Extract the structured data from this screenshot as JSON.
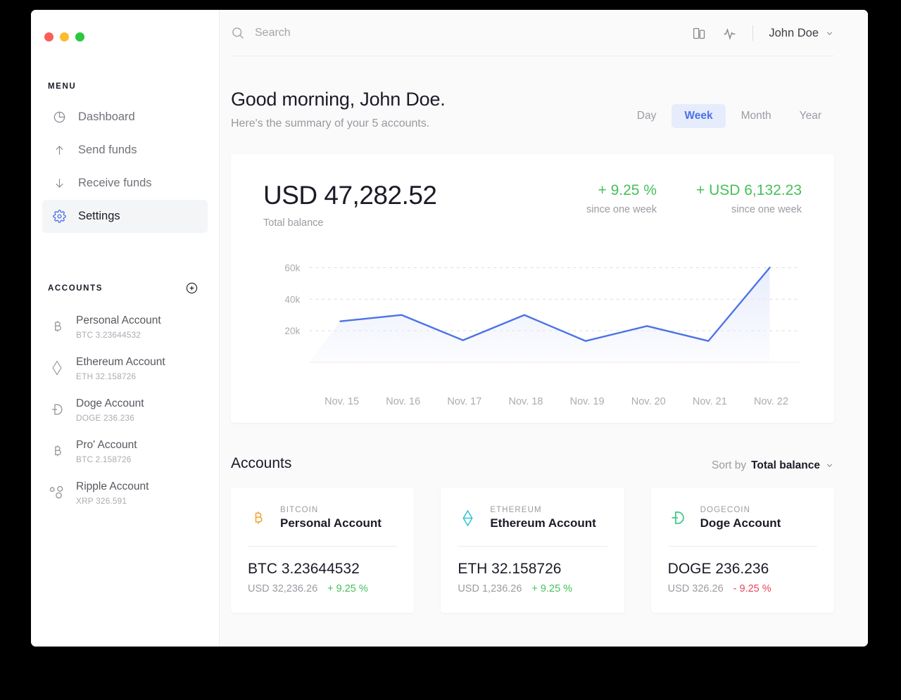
{
  "window": {
    "traffic_lights": [
      "close",
      "minimize",
      "maximize"
    ]
  },
  "sidebar": {
    "menu_label": "MENU",
    "menu_items": [
      {
        "label": "Dashboard",
        "icon": "pie-chart-icon",
        "active": false
      },
      {
        "label": "Send funds",
        "icon": "arrow-up-icon",
        "active": false
      },
      {
        "label": "Receive funds",
        "icon": "arrow-down-icon",
        "active": false
      },
      {
        "label": "Settings",
        "icon": "gear-icon",
        "active": true
      }
    ],
    "accounts_label": "ACCOUNTS",
    "add_account_icon": "plus-circle-icon",
    "accounts": [
      {
        "name": "Personal Account",
        "balance": "BTC 3.23644532",
        "icon": "bitcoin-icon"
      },
      {
        "name": "Ethereum Account",
        "balance": "ETH 32.158726",
        "icon": "ethereum-icon"
      },
      {
        "name": "Doge Account",
        "balance": "DOGE 236.236",
        "icon": "dogecoin-icon"
      },
      {
        "name": "Pro' Account",
        "balance": "BTC 2.158726",
        "icon": "bitcoin-icon"
      },
      {
        "name": "Ripple Account",
        "balance": "XRP 326.591",
        "icon": "ripple-icon"
      }
    ]
  },
  "topbar": {
    "search_placeholder": "Search",
    "search_value": "",
    "search_icon": "search-icon",
    "device_icon": "device-icon",
    "activity_icon": "activity-pulse-icon",
    "user_name": "John Doe",
    "caret_icon": "chevron-down-icon"
  },
  "header": {
    "greeting": "Good morning, John Doe.",
    "subtitle": "Here's the summary of your 5 accounts.",
    "ranges": [
      {
        "label": "Day",
        "active": false
      },
      {
        "label": "Week",
        "active": true
      },
      {
        "label": "Month",
        "active": false
      },
      {
        "label": "Year",
        "active": false
      }
    ]
  },
  "balance_card": {
    "amount": "USD 47,282.52",
    "caption": "Total balance",
    "stats": [
      {
        "value": "+ 9.25 %",
        "sub": "since one week"
      },
      {
        "value": "+ USD 6,132.23",
        "sub": "since one week"
      }
    ]
  },
  "chart_data": {
    "type": "area",
    "title": "",
    "xlabel": "",
    "ylabel": "",
    "categories": [
      "Nov. 15",
      "Nov. 16",
      "Nov. 17",
      "Nov. 18",
      "Nov. 19",
      "Nov. 20",
      "Nov. 21",
      "Nov. 22"
    ],
    "values": [
      26000,
      30000,
      14000,
      30000,
      13500,
      23000,
      13500,
      60000
    ],
    "ytick_labels": [
      "60k",
      "40k",
      "20k"
    ],
    "yticks": [
      60000,
      40000,
      20000
    ],
    "ylim": [
      0,
      66000
    ],
    "grid": true,
    "legend": "none",
    "line_color": "#4b72e8",
    "fill_color": "#e7ecfb"
  },
  "accounts_section": {
    "title": "Accounts",
    "sort_prefix": "Sort by",
    "sort_value": "Total balance",
    "sort_caret": "chevron-down-icon",
    "cards": [
      {
        "currency": "BITCOIN",
        "name": "Personal Account",
        "amount": "BTC 3.23644532",
        "usd": "USD 32,236.26",
        "change": "+ 9.25 %",
        "direction": "up",
        "icon": "bitcoin-icon",
        "color": "#f0a93c"
      },
      {
        "currency": "ETHEREUM",
        "name": "Ethereum Account",
        "amount": "ETH 32.158726",
        "usd": "USD 1,236.26",
        "change": "+ 9.25 %",
        "direction": "up",
        "icon": "ethereum-icon",
        "color": "#2ec4d6"
      },
      {
        "currency": "DOGECOIN",
        "name": "Doge Account",
        "amount": "DOGE 236.236",
        "usd": "USD 326.26",
        "change": "- 9.25 %",
        "direction": "down",
        "icon": "dogecoin-icon",
        "color": "#3ec98a"
      }
    ]
  },
  "colors": {
    "accent_blue": "#4b72e8",
    "positive_green": "#46c05a",
    "negative_red": "#e8445a",
    "bitcoin_orange": "#f0a93c",
    "ethereum_cyan": "#2ec4d6",
    "doge_green": "#3ec98a"
  }
}
